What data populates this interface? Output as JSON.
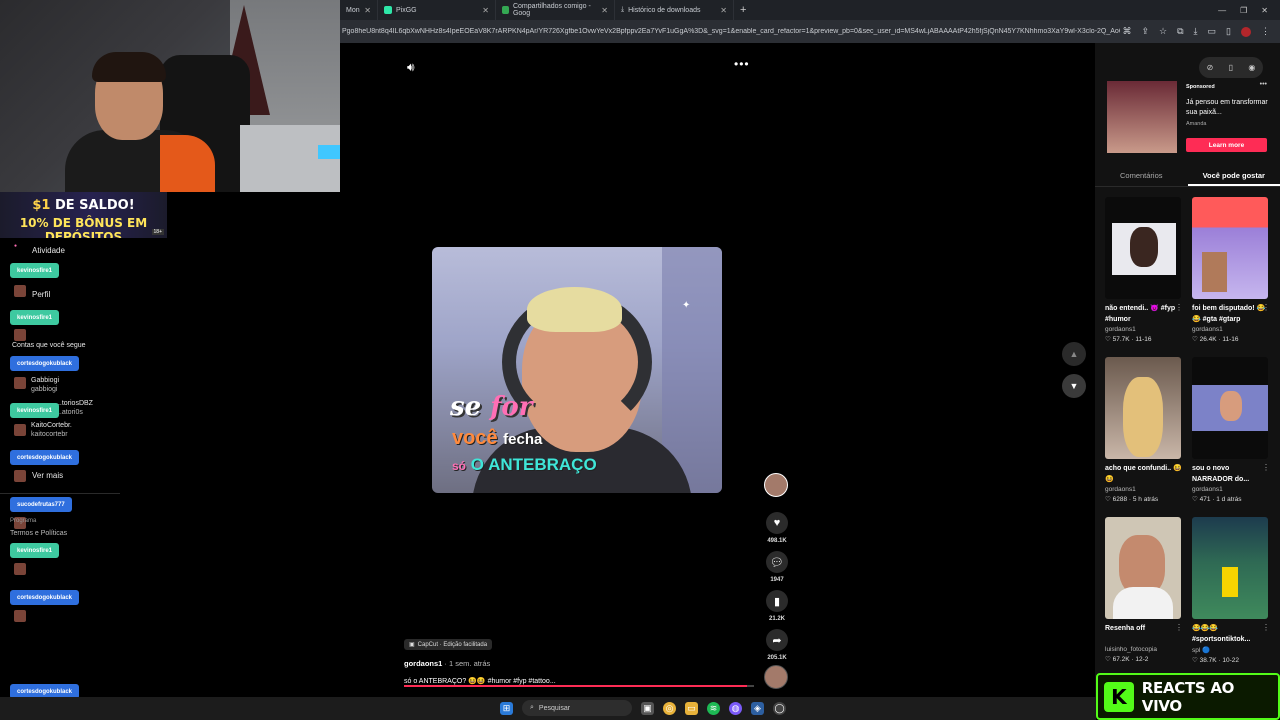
{
  "browser": {
    "tabs": [
      {
        "label": "Mon",
        "favicon": "tab-icon",
        "color": "#8ab4f8"
      },
      {
        "label": "PixGG",
        "favicon": "pixgg-icon",
        "color": "#2ee6a8"
      },
      {
        "label": "Compartilhados comigo - Goog",
        "favicon": "drive-icon",
        "color": "#34a853"
      },
      {
        "label": "Histórico de downloads",
        "favicon": "download-icon",
        "color": "#cccccc"
      }
    ],
    "new_tab": "+",
    "url": "Pgo8heU8nt8q4IL6qbXwNHHz8s4IpeEOEaV8K7rARPKN4pAr/YR726Xgfbe1OvwYeVx2Bpfppv2Ea7YvF1uGgA%3D&_svg=1&enable_card_refactor=1&preview_pb=0&sec_user_id=MS4wLjABAAAAtP42h5fjSjQnN45Y7KNhhmo3XaY9wl-X3clo-2Q_Ao6pTIH"
  },
  "stream": {
    "promo_line1_prefix": "$1",
    "promo_line1_rest": " DE SALDO!",
    "promo_line2": "10% DE BÔNUS EM DEPÓSITOS",
    "promo_tag": "18+",
    "nav": {
      "activity": "Atividade",
      "profile": "Perfil",
      "following_accounts": "Contas que você segue",
      "see_more": "Ver mais",
      "program": "Programa",
      "terms": "Termos e Políticas"
    },
    "followed": [
      {
        "name": "Gabbiogi",
        "handle": "gabbiogi"
      },
      {
        "name": "...toriosDBZ",
        "handle": "...atori0s"
      },
      {
        "name": "KaitoCortebr.",
        "handle": "kaitocortebr"
      }
    ],
    "chat_badges": [
      "kevinosfire1",
      "kevinosfire1",
      "cortesdogokublack",
      "kevinosfire1",
      "cortesdogokublack",
      "sucodefrutas777",
      "kevinosfire1",
      "cortesdogokublack",
      "cortesdogokublack"
    ]
  },
  "video": {
    "caption_se": "se",
    "caption_for": "for",
    "caption_voce": "você",
    "caption_fecha": "fecha",
    "caption_so": "só",
    "caption_antebraco": "O ANTEBRAÇO",
    "capcut_label": "CapCut · Edição facilitada",
    "author": "gordaons1",
    "posted": " · 1 sem. atrás",
    "description": "só o ANTEBRAÇO? 😆😆 #humor #fyp #tattoo...",
    "progress": 0.98,
    "likes": "498.1K",
    "comments": "1947",
    "saves": "21.2K",
    "shares": "205.1K"
  },
  "right_panel": {
    "ad": {
      "sponsored": "Sponsored",
      "title": "Já pensou em transformar sua paixã...",
      "advertiser": "Amanda",
      "cta": "Learn more"
    },
    "tabs": {
      "comments": "Comentários",
      "you_may_like": "Você pode gostar"
    },
    "cards": [
      {
        "caption": "não entendi.. 😈 #fyp #humor",
        "author": "gordaons1",
        "stats": "♡ 57.7K · 11-16",
        "bg": "#e9e9ee"
      },
      {
        "caption": "foi bem disputado! 😂😂 #gta #gtarp",
        "author": "gordaons1",
        "stats": "♡ 26.4K · 11-16",
        "bg": "#9b7fd8"
      },
      {
        "caption": "acho que confundi.. 😆😆",
        "author": "gordaons1",
        "stats": "♡ 6288 · 5 h atrás",
        "bg": "#c9b6a8"
      },
      {
        "caption": "sou o novo NARRADOR do...",
        "author": "gordaons1",
        "stats": "♡ 471 · 1 d atrás",
        "bg": "#7c82c8"
      },
      {
        "caption": "Resenha off",
        "author": "luisinho_fotocopia",
        "stats": "♡ 67.2K · 12-2",
        "bg": "#cfc6b5"
      },
      {
        "caption": "😂😂😂 #sportsontiktok...",
        "author": "spl 🔵",
        "stats": "♡ 38.7K · 10-22",
        "bg": "#2f6a54"
      }
    ]
  },
  "reacts_banner": {
    "logo": "K",
    "text": "REACTS AO VIVO",
    "color": "#53fc18"
  },
  "taskbar": {
    "search": "Pesquisar"
  }
}
